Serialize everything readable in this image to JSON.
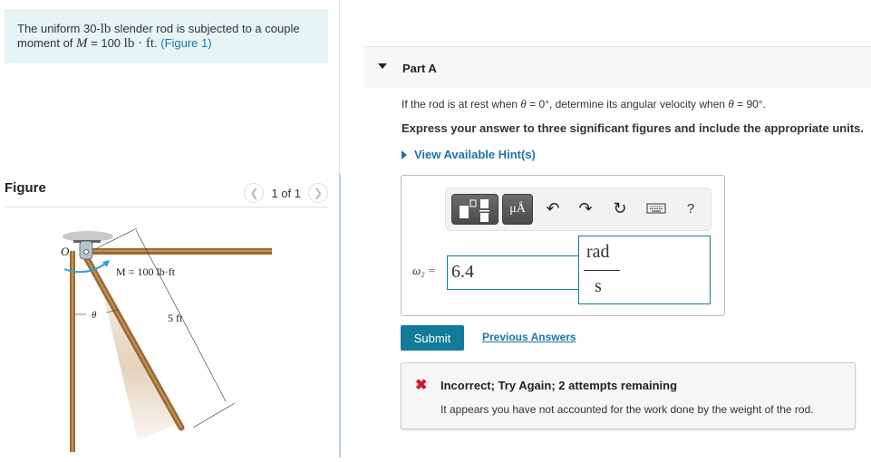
{
  "problem": {
    "text_prefix": "The uniform 30-",
    "weight_unit": "lb",
    "text_middle": " slender rod is subjected to a couple moment of ",
    "moment_symbol": "M",
    "moment_eq": " = 100 ",
    "moment_unit": "lb · ft",
    "period": ".",
    "figure_link": "(Figure 1)"
  },
  "figure_panel": {
    "title": "Figure",
    "pager_text": "1 of 1",
    "prev_icon": "chevron-left-icon",
    "next_icon": "chevron-right-icon",
    "labels": {
      "pivot": "O",
      "moment": "M = 100 lb·ft",
      "angle": "θ",
      "length": "5 ft"
    }
  },
  "part": {
    "title": "Part A",
    "question_a": "If the rod is at rest when ",
    "theta": "θ",
    "question_b": " = 0°, determine its angular velocity when ",
    "question_c": " = 90°.",
    "instruction": "Express your answer to three significant figures and include the appropriate units.",
    "hints_label": "View Available Hint(s)"
  },
  "answer": {
    "toolbar": {
      "templates_icon": "templates-icon",
      "units_label": "μÅ",
      "undo_icon": "undo-icon",
      "redo_icon": "redo-icon",
      "reset_icon": "reset-icon",
      "keyboard_icon": "keyboard-icon",
      "help_label": "?"
    },
    "variable_label": "ω₂ =",
    "value": "6.4",
    "unit_numerator": "rad",
    "unit_denominator": "s"
  },
  "actions": {
    "submit_label": "Submit",
    "previous_answers_label": "Previous Answers"
  },
  "feedback": {
    "status_icon": "x-icon",
    "title": "Incorrect; Try Again; 2 attempts remaining",
    "message": "It appears you have not accounted for the work done by the weight of the rod."
  },
  "colors": {
    "accent": "#127b9a",
    "link": "#1a76a9",
    "error": "#d2142c",
    "problem_bg": "#e6f4f6"
  }
}
